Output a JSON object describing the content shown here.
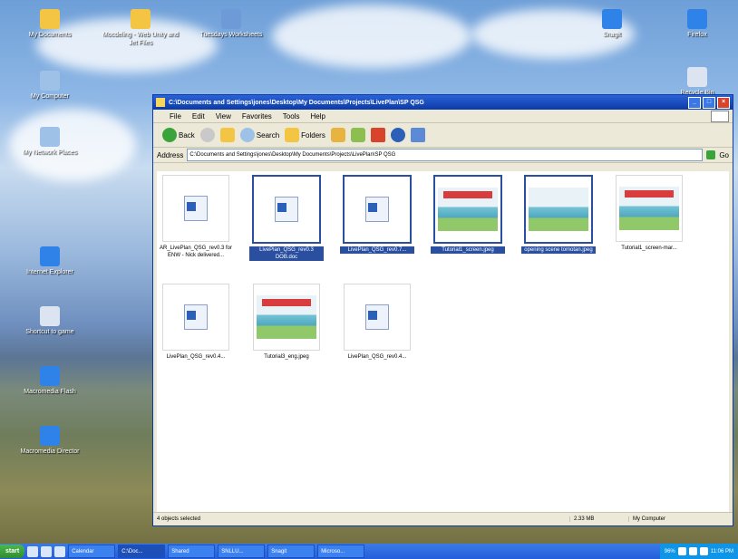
{
  "desktop": {
    "icons": [
      {
        "label": "My Documents",
        "color": "#f4c542"
      },
      {
        "label": "Mocdeling - Web Unity and Jet Files",
        "color": "#f4c542"
      },
      {
        "label": "Tuesdays Worksheets",
        "color": "#6f9ad8"
      },
      {
        "label": "My Computer",
        "color": "#9ec1e8"
      },
      {
        "label": "My Network Places",
        "color": "#9ec1e8"
      },
      {
        "label": "Recycle Bin",
        "color": "#dbe4f0"
      },
      {
        "label": "Internet Explorer",
        "color": "#2f83e8"
      },
      {
        "label": "Macromedia Flash",
        "color": "#2f83e8"
      },
      {
        "label": "Macromedia Director",
        "color": "#2f83e8"
      },
      {
        "label": "Shortcut to game",
        "color": "#dbe4f0"
      },
      {
        "label": "Snagit",
        "color": "#2f83e8"
      },
      {
        "label": "Firefox",
        "color": "#2f83e8"
      }
    ]
  },
  "window": {
    "title": "C:\\Documents and Settings\\jones\\Desktop\\My Documents\\Projects\\LivePlan\\SP QSG",
    "menu": [
      "File",
      "Edit",
      "View",
      "Favorites",
      "Tools",
      "Help"
    ],
    "toolbar": {
      "back": "Back",
      "search": "Search",
      "folders": "Folders"
    },
    "address_label": "Address",
    "address_value": "C:\\Documents and Settings\\jones\\Desktop\\My Documents\\Projects\\LivePlan\\SP QSG",
    "go_label": "Go",
    "files": [
      {
        "name": "AR_LivePlan_QSG_rev0.3 for ENW - Nick delivered...",
        "type": "doc",
        "selected": false
      },
      {
        "name": "LivePlan_QSG_rev0.3 DOB.doc",
        "type": "doc",
        "selected": true
      },
      {
        "name": "LivePlan_QSG_rev0.7...",
        "type": "doc",
        "selected": true
      },
      {
        "name": "Tutorial1_screen.jpeg",
        "type": "img",
        "selected": true
      },
      {
        "name": "opening scene tomotan.jpeg",
        "type": "img",
        "selected": true
      },
      {
        "name": "Tutorial1_screen-mar...",
        "type": "img",
        "selected": false
      },
      {
        "name": "LivePlan_QSG_rev0.4...",
        "type": "doc",
        "selected": false
      },
      {
        "name": "Tutorial3_eng.jpeg",
        "type": "img",
        "selected": false
      },
      {
        "name": "LivePlan_QSG_rev0.4...",
        "type": "doc",
        "selected": false
      }
    ],
    "status": {
      "selection": "4 objects selected",
      "size": "2.33 MB",
      "location": "My Computer"
    }
  },
  "taskbar": {
    "start": "start",
    "tasks": [
      "Calendar",
      "C:\\Doc...",
      "Shared",
      "SNLLU...",
      "Snagit",
      "Microso..."
    ],
    "tray": {
      "percent": "96%",
      "time": "11:06 PM"
    }
  }
}
